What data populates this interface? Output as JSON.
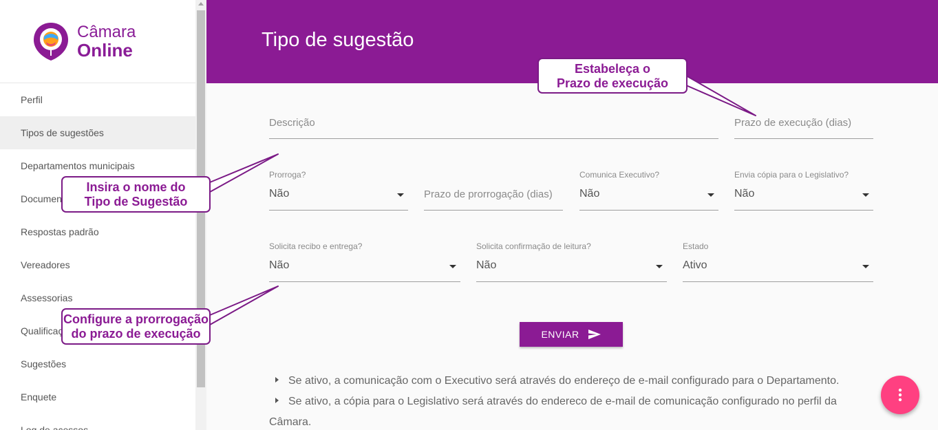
{
  "sidebar": {
    "logo": {
      "line1": "Câmara",
      "line2": "Online"
    },
    "items": [
      {
        "label": "Perfil"
      },
      {
        "label": "Tipos de sugestões"
      },
      {
        "label": "Departamentos municipais"
      },
      {
        "label": "Documentos"
      },
      {
        "label": "Respostas padrão"
      },
      {
        "label": "Vereadores"
      },
      {
        "label": "Assessorias"
      },
      {
        "label": "Qualificação"
      },
      {
        "label": "Sugestões"
      },
      {
        "label": "Enquete"
      },
      {
        "label": "Log de acessos"
      }
    ]
  },
  "header": {
    "title": "Tipo de sugestão"
  },
  "form": {
    "descricao": {
      "placeholder": "Descrição"
    },
    "prazo_execucao": {
      "placeholder": "Prazo de execução (dias)"
    },
    "prorroga": {
      "label": "Prorroga?",
      "value": "Não"
    },
    "prazo_prorrogacao": {
      "placeholder": "Prazo de prorrogação (dias)"
    },
    "comunica_executivo": {
      "label": "Comunica Executivo?",
      "value": "Não"
    },
    "envia_copia": {
      "label": "Envia cópia para o Legislativo?",
      "value": "Não"
    },
    "solicita_recibo": {
      "label": "Solicita recibo e entrega?",
      "value": "Não"
    },
    "solicita_confirmacao": {
      "label": "Solicita confirmação de leitura?",
      "value": "Não"
    },
    "estado": {
      "label": "Estado",
      "value": "Ativo"
    },
    "submit_label": "ENVIAR"
  },
  "notes": {
    "n1": "Se ativo, a comunicação com o Executivo será através do endereço de e-mail configurado para o Departamento.",
    "n2a": "Se ativo, a cópia para o Legislativo será através do endereco de e-mail de comunicação configurado no perfil da",
    "n2b": "Câmara."
  },
  "callouts": {
    "prazo": {
      "line1": "Estabeleça o",
      "line2": "Prazo de execução"
    },
    "nome": {
      "line1": "Insira o nome do",
      "line2": "Tipo de Sugestão"
    },
    "prorrogacao": {
      "line1": "Configure a prorrogação",
      "line2": "do prazo de execução"
    }
  },
  "icons": {
    "fab": "more-vert-icon",
    "send": "send-icon",
    "logo": "map-pin-globe-icon"
  },
  "colors": {
    "primary": "#8b1b94",
    "fab": "#ff4081",
    "callout_text": "#8b1b94"
  }
}
